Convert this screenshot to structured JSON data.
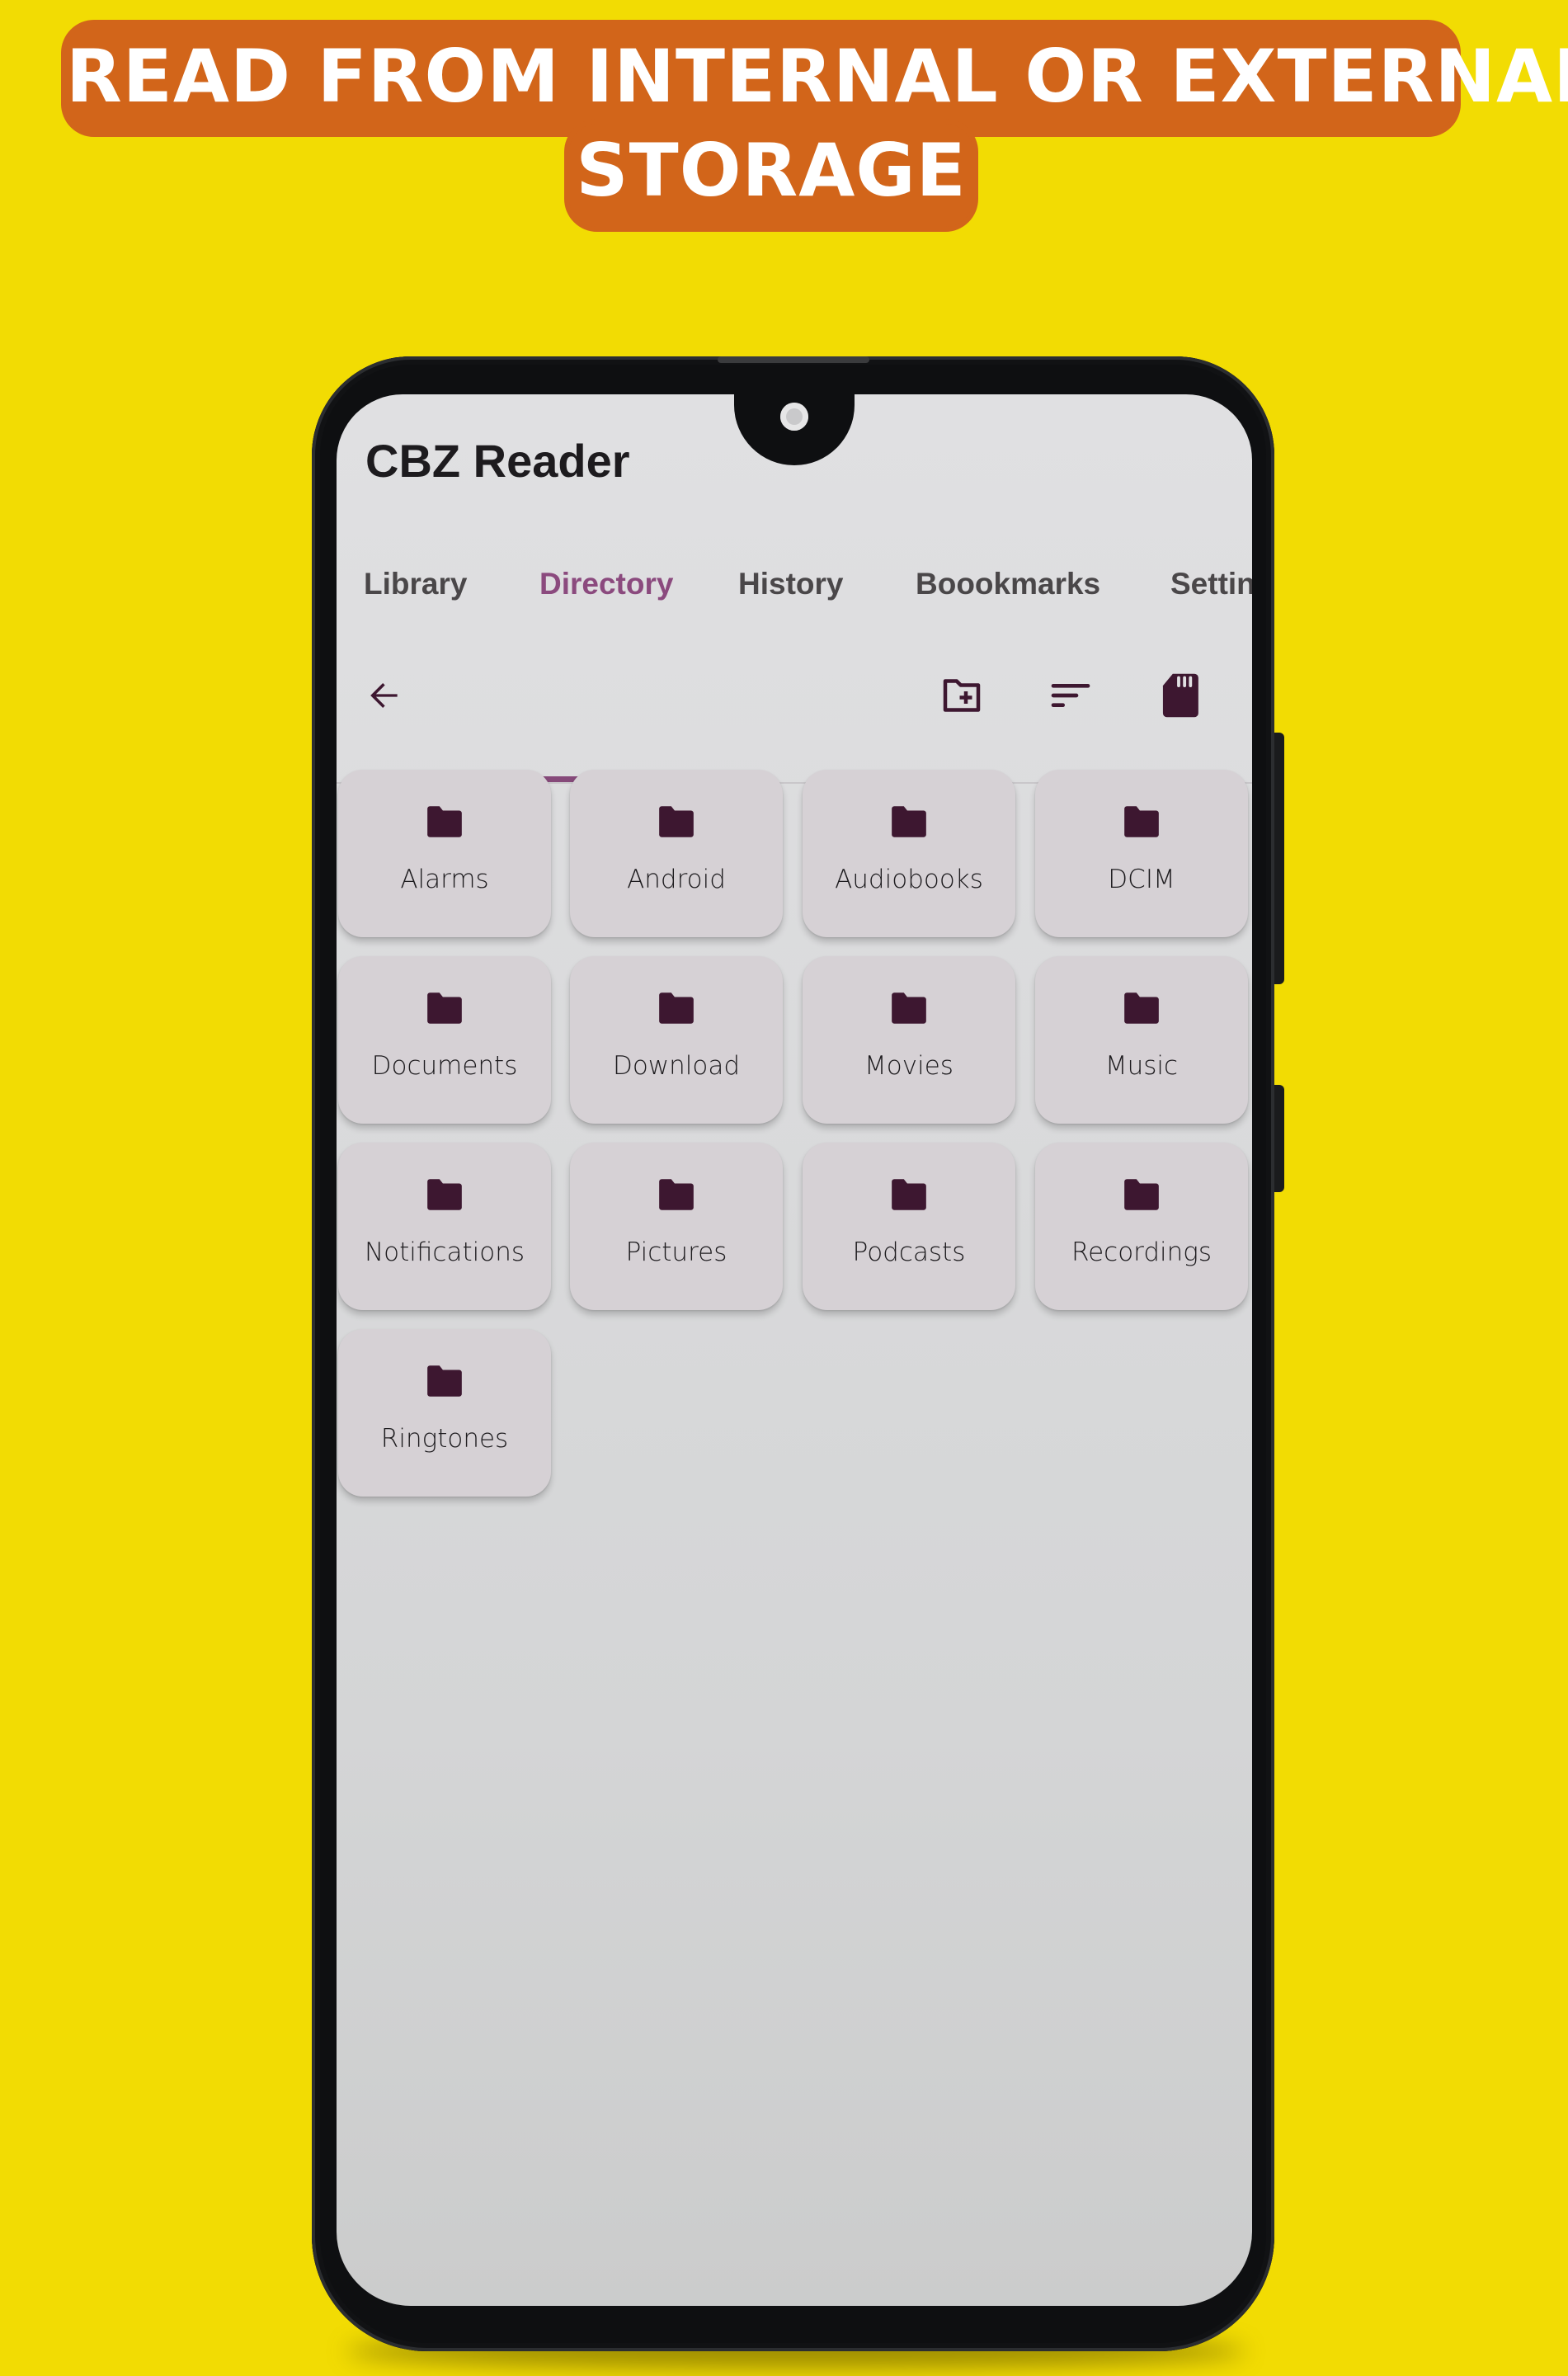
{
  "banner": {
    "line1": "READ FROM INTERNAL OR EXTERNAL",
    "line2": "STORAGE",
    "bg_color": "#d2651a",
    "text_color": "#ffffff"
  },
  "app": {
    "title": "CBZ Reader",
    "accent_color": "#864a7a",
    "icon_color": "#3d1730"
  },
  "tabs": [
    {
      "label": "Library",
      "active": false
    },
    {
      "label": "Directory",
      "active": true
    },
    {
      "label": "History",
      "active": false
    },
    {
      "label": "Boookmarks",
      "active": false
    },
    {
      "label": "Settin",
      "active": false
    }
  ],
  "toolbar": {
    "back_icon": "arrow-back-icon",
    "new_folder_icon": "create-new-folder-icon",
    "sort_icon": "sort-icon",
    "storage_icon": "sd-card-icon"
  },
  "folders": [
    {
      "name": "Alarms"
    },
    {
      "name": "Android"
    },
    {
      "name": "Audiobooks"
    },
    {
      "name": "DCIM"
    },
    {
      "name": "Documents"
    },
    {
      "name": "Download"
    },
    {
      "name": "Movies"
    },
    {
      "name": "Music"
    },
    {
      "name": "Notifications"
    },
    {
      "name": "Pictures"
    },
    {
      "name": "Podcasts"
    },
    {
      "name": "Recordings"
    },
    {
      "name": "Ringtones"
    }
  ]
}
